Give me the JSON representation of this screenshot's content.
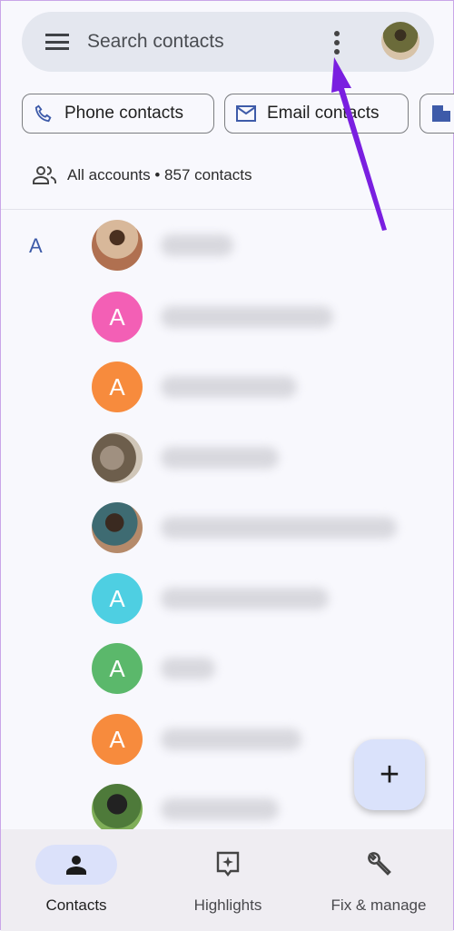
{
  "search": {
    "placeholder": "Search contacts"
  },
  "chips": [
    {
      "label": "Phone contacts",
      "icon": "phone-icon"
    },
    {
      "label": "Email contacts",
      "icon": "email-icon"
    },
    {
      "label": "",
      "icon": "building-icon"
    }
  ],
  "accounts": {
    "label": "All accounts • 857 contacts"
  },
  "section_letter": "A",
  "contacts": [
    {
      "avatar": "photo",
      "initial": ""
    },
    {
      "avatar": "initial",
      "initial": "A",
      "color": "#f35fb5"
    },
    {
      "avatar": "initial",
      "initial": "A",
      "color": "#f78b3d"
    },
    {
      "avatar": "photo",
      "initial": ""
    },
    {
      "avatar": "photo",
      "initial": ""
    },
    {
      "avatar": "initial",
      "initial": "A",
      "color": "#4ecfe2"
    },
    {
      "avatar": "initial",
      "initial": "A",
      "color": "#5bb86b"
    },
    {
      "avatar": "initial",
      "initial": "A",
      "color": "#f78b3d"
    },
    {
      "avatar": "photo",
      "initial": ""
    }
  ],
  "fab": {
    "label": "+"
  },
  "nav": [
    {
      "label": "Contacts",
      "icon": "person-icon",
      "active": true
    },
    {
      "label": "Highlights",
      "icon": "highlights-icon"
    },
    {
      "label": "Fix & manage",
      "icon": "wrench-icon"
    }
  ],
  "colors": {
    "accent": "#3e5ba9",
    "arrow": "#7a1fe0"
  }
}
